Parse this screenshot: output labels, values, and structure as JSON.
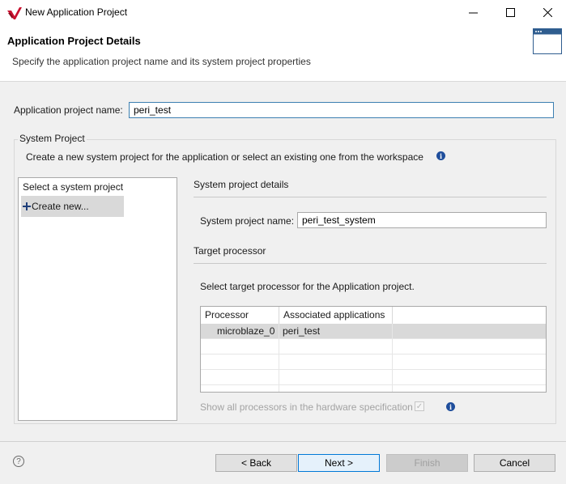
{
  "window": {
    "title": "New Application Project",
    "controls": {
      "minimize_icon": "minimize-icon",
      "maximize_icon": "maximize-icon",
      "close_icon": "close-icon"
    }
  },
  "header": {
    "title": "Application Project Details",
    "description": "Specify the application project name and its system project properties",
    "icon": "wizard-window-icon"
  },
  "form": {
    "app_name_label": "Application project name:",
    "app_name_value": "peri_test"
  },
  "system_project": {
    "group_title": "System Project",
    "intro": "Create a new system project for the application or select an existing one from the workspace",
    "list_title": "Select a system project",
    "create_new_label": "Create new...",
    "details_title": "System project details",
    "name_label": "System project name:",
    "name_value": "peri_test_system",
    "target_title": "Target processor",
    "target_desc": "Select target processor for the Application project.",
    "table": {
      "headers": [
        "Processor",
        "Associated applications"
      ],
      "rows": [
        {
          "processor": "microblaze_0",
          "apps": "peri_test",
          "selected": true
        }
      ]
    },
    "show_all_label": "Show all processors in the hardware specification",
    "show_all_checked": true
  },
  "footer": {
    "back_label": "< Back",
    "next_label": "Next >",
    "finish_label": "Finish",
    "cancel_label": "Cancel"
  },
  "colors": {
    "accent": "#0078d7",
    "logo": "#c8102e",
    "info": "#1f4e9c",
    "selection": "#d9d9d9"
  }
}
